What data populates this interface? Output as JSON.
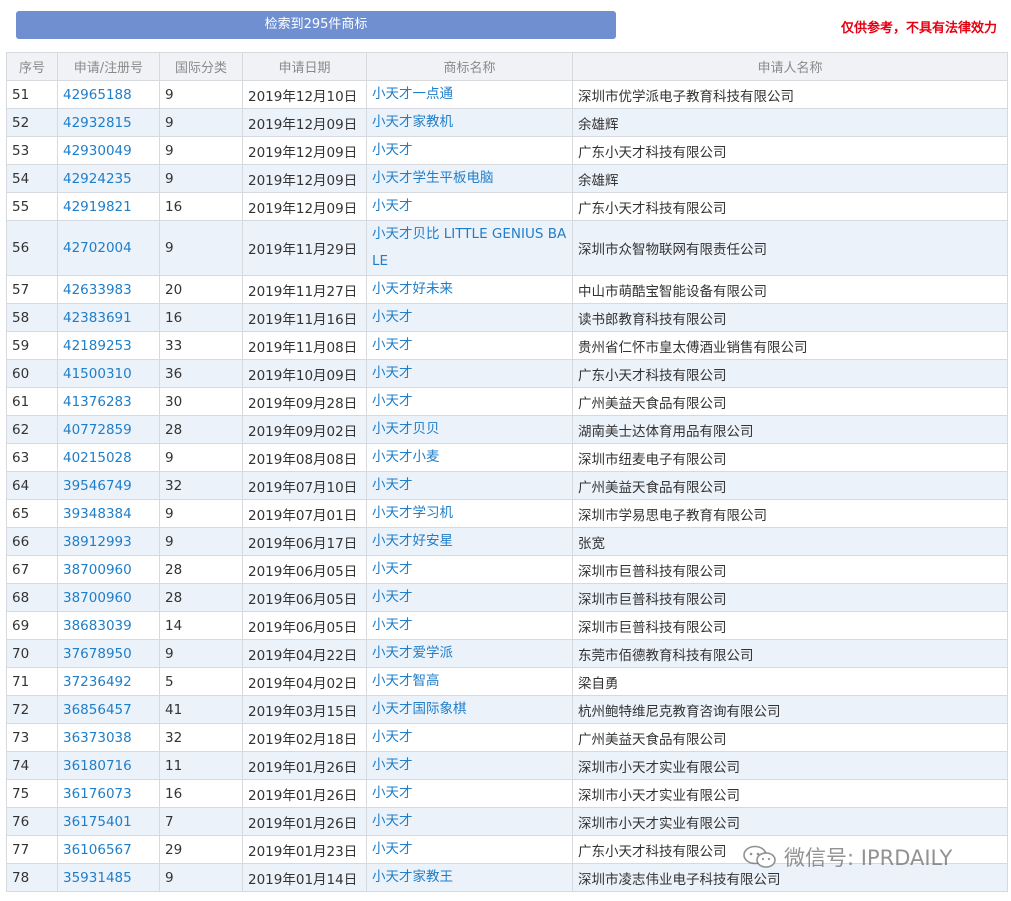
{
  "header": {
    "result_text": "检索到295件商标",
    "disclaimer": "仅供参考，不具有法律效力"
  },
  "table": {
    "columns": [
      "序号",
      "申请/注册号",
      "国际分类",
      "申请日期",
      "商标名称",
      "申请人名称"
    ],
    "rows": [
      {
        "no": "51",
        "reg": "42965188",
        "cls": "9",
        "date": "2019年12月10日",
        "mark": "小天才一点通",
        "applicant": "深圳市优学派电子教育科技有限公司"
      },
      {
        "no": "52",
        "reg": "42932815",
        "cls": "9",
        "date": "2019年12月09日",
        "mark": "小天才家教机",
        "applicant": "余雄辉"
      },
      {
        "no": "53",
        "reg": "42930049",
        "cls": "9",
        "date": "2019年12月09日",
        "mark": "小天才",
        "applicant": "广东小天才科技有限公司"
      },
      {
        "no": "54",
        "reg": "42924235",
        "cls": "9",
        "date": "2019年12月09日",
        "mark": "小天才学生平板电脑",
        "applicant": "余雄辉"
      },
      {
        "no": "55",
        "reg": "42919821",
        "cls": "16",
        "date": "2019年12月09日",
        "mark": "小天才",
        "applicant": "广东小天才科技有限公司"
      },
      {
        "no": "56",
        "reg": "42702004",
        "cls": "9",
        "date": "2019年11月29日",
        "mark": "小天才贝比 LITTLE GENIUS BA LE",
        "applicant": "深圳市众智物联网有限责任公司"
      },
      {
        "no": "57",
        "reg": "42633983",
        "cls": "20",
        "date": "2019年11月27日",
        "mark": "小天才好未来",
        "applicant": "中山市萌酷宝智能设备有限公司"
      },
      {
        "no": "58",
        "reg": "42383691",
        "cls": "16",
        "date": "2019年11月16日",
        "mark": "小天才",
        "applicant": "读书郎教育科技有限公司"
      },
      {
        "no": "59",
        "reg": "42189253",
        "cls": "33",
        "date": "2019年11月08日",
        "mark": "小天才",
        "applicant": "贵州省仁怀市皇太傅酒业销售有限公司"
      },
      {
        "no": "60",
        "reg": "41500310",
        "cls": "36",
        "date": "2019年10月09日",
        "mark": "小天才",
        "applicant": "广东小天才科技有限公司"
      },
      {
        "no": "61",
        "reg": "41376283",
        "cls": "30",
        "date": "2019年09月28日",
        "mark": "小天才",
        "applicant": "广州美益天食品有限公司"
      },
      {
        "no": "62",
        "reg": "40772859",
        "cls": "28",
        "date": "2019年09月02日",
        "mark": "小天才贝贝",
        "applicant": "湖南美士达体育用品有限公司"
      },
      {
        "no": "63",
        "reg": "40215028",
        "cls": "9",
        "date": "2019年08月08日",
        "mark": "小天才小麦",
        "applicant": "深圳市纽麦电子有限公司"
      },
      {
        "no": "64",
        "reg": "39546749",
        "cls": "32",
        "date": "2019年07月10日",
        "mark": "小天才",
        "applicant": "广州美益天食品有限公司"
      },
      {
        "no": "65",
        "reg": "39348384",
        "cls": "9",
        "date": "2019年07月01日",
        "mark": "小天才学习机",
        "applicant": "深圳市学易思电子教育有限公司"
      },
      {
        "no": "66",
        "reg": "38912993",
        "cls": "9",
        "date": "2019年06月17日",
        "mark": "小天才好安星",
        "applicant": "张宽"
      },
      {
        "no": "67",
        "reg": "38700960",
        "cls": "28",
        "date": "2019年06月05日",
        "mark": "小天才",
        "applicant": "深圳市巨普科技有限公司"
      },
      {
        "no": "68",
        "reg": "38700960",
        "cls": "28",
        "date": "2019年06月05日",
        "mark": "小天才",
        "applicant": "深圳市巨普科技有限公司"
      },
      {
        "no": "69",
        "reg": "38683039",
        "cls": "14",
        "date": "2019年06月05日",
        "mark": "小天才",
        "applicant": "深圳市巨普科技有限公司"
      },
      {
        "no": "70",
        "reg": "37678950",
        "cls": "9",
        "date": "2019年04月22日",
        "mark": "小天才爱学派",
        "applicant": "东莞市佰德教育科技有限公司"
      },
      {
        "no": "71",
        "reg": "37236492",
        "cls": "5",
        "date": "2019年04月02日",
        "mark": "小天才智高",
        "applicant": "梁自勇"
      },
      {
        "no": "72",
        "reg": "36856457",
        "cls": "41",
        "date": "2019年03月15日",
        "mark": "小天才国际象棋",
        "applicant": "杭州鲍特维尼克教育咨询有限公司"
      },
      {
        "no": "73",
        "reg": "36373038",
        "cls": "32",
        "date": "2019年02月18日",
        "mark": "小天才",
        "applicant": "广州美益天食品有限公司"
      },
      {
        "no": "74",
        "reg": "36180716",
        "cls": "11",
        "date": "2019年01月26日",
        "mark": "小天才",
        "applicant": "深圳市小天才实业有限公司"
      },
      {
        "no": "75",
        "reg": "36176073",
        "cls": "16",
        "date": "2019年01月26日",
        "mark": "小天才",
        "applicant": "深圳市小天才实业有限公司"
      },
      {
        "no": "76",
        "reg": "36175401",
        "cls": "7",
        "date": "2019年01月26日",
        "mark": "小天才",
        "applicant": "深圳市小天才实业有限公司"
      },
      {
        "no": "77",
        "reg": "36106567",
        "cls": "29",
        "date": "2019年01月23日",
        "mark": "小天才",
        "applicant": "广东小天才科技有限公司"
      },
      {
        "no": "78",
        "reg": "35931485",
        "cls": "9",
        "date": "2019年01月14日",
        "mark": "小天才家教王",
        "applicant": "深圳市凌志伟业电子科技有限公司"
      }
    ]
  },
  "watermark": {
    "text": "微信号: IPRDAILY",
    "icon": "wechat-icon"
  }
}
